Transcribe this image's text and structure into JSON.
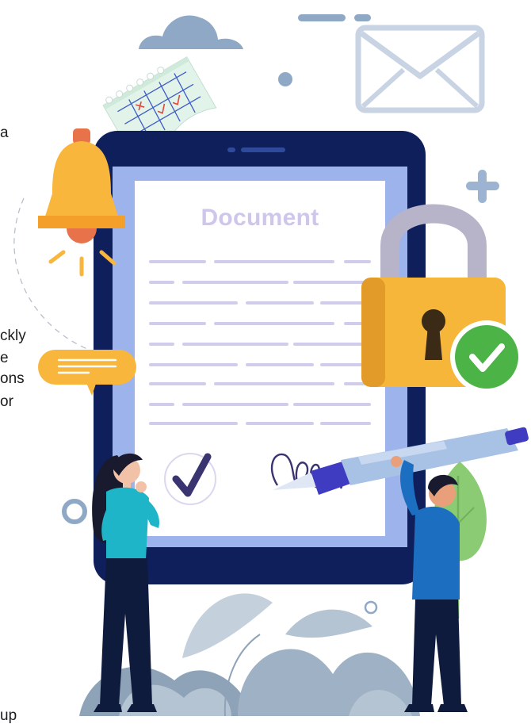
{
  "document": {
    "title": "Document"
  },
  "side_text": [
    "a",
    "ckly",
    "e",
    "ons",
    "or",
    "up"
  ],
  "colors": {
    "tablet_frame": "#0e1f5c",
    "tablet_screen_border": "#9db3ec",
    "document_title": "#cfc6ec",
    "lock_body": "#f5b63a",
    "lock_shackle": "#b7b3c8",
    "check_badge": "#4cb447",
    "bell": "#f8b63c",
    "cloud": "#8ea8c6",
    "envelope": "#c8d3e3",
    "pen": "#a8c2e6",
    "man_shirt": "#1c6fc0",
    "woman_top": "#1fb5c9",
    "plant": "#8fa3b8"
  },
  "icons": [
    "cloud-icon",
    "envelope-icon",
    "calendar-icon",
    "bell-icon",
    "speech-bubble-icon",
    "padlock-icon",
    "check-badge-icon",
    "checkmark-icon",
    "signature-icon",
    "pen-icon",
    "plus-icon"
  ]
}
